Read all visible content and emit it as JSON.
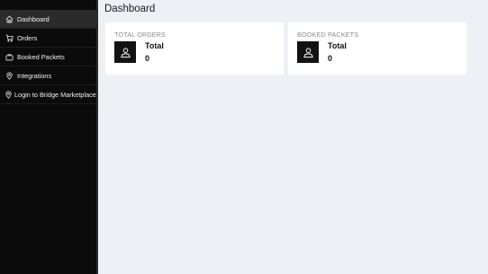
{
  "sidebar": {
    "items": [
      {
        "label": "Dashboard",
        "icon": "home-icon",
        "active": true
      },
      {
        "label": "Orders",
        "icon": "cart-icon"
      },
      {
        "label": "Booked Packets",
        "icon": "bag-icon"
      },
      {
        "label": "Integrations",
        "icon": "map-pin-icon"
      },
      {
        "label": "Login to Bridge Marketplace",
        "icon": "map-pin-icon"
      }
    ]
  },
  "main": {
    "title": "Dashboard",
    "cards": [
      {
        "label": "TOTAL ORDERS",
        "stat_name": "Total",
        "stat_value": "0",
        "icon": "user-icon"
      },
      {
        "label": "BOOKED PACKETS",
        "stat_name": "Total",
        "stat_value": "0",
        "icon": "user-icon"
      }
    ]
  }
}
